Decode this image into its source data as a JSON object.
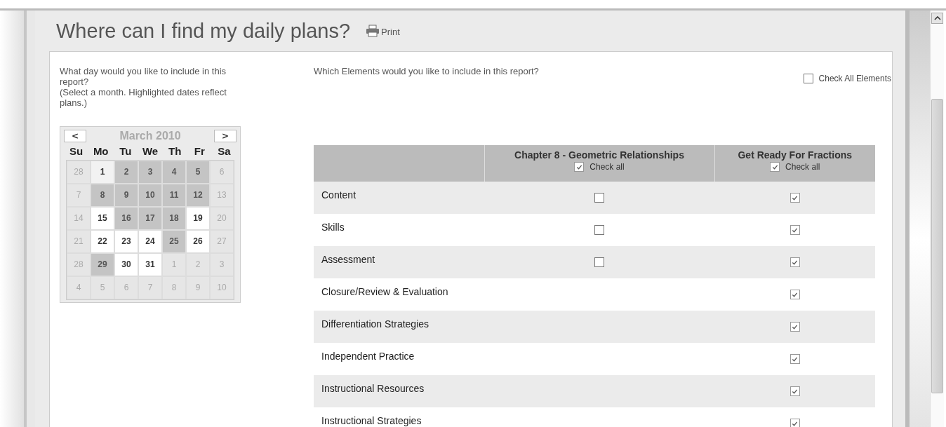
{
  "page": {
    "title": "Where can I find my daily plans?",
    "print_label": "Print"
  },
  "day_prompt": {
    "question": "What day would you like to include in this report?",
    "hint": "(Select a month. Highlighted dates reflect plans.)"
  },
  "elements_prompt": "Which Elements would you like to include in this report?",
  "check_all_elements": {
    "label": "Check All Elements",
    "checked": false
  },
  "calendar": {
    "prev": "<",
    "next": ">",
    "month": "March 2010",
    "weekdays": [
      "Su",
      "Mo",
      "Tu",
      "We",
      "Th",
      "Fr",
      "Sa"
    ],
    "days": [
      {
        "label": "28",
        "kind": "other"
      },
      {
        "label": "1",
        "kind": "today"
      },
      {
        "label": "2",
        "kind": "plan"
      },
      {
        "label": "3",
        "kind": "plan"
      },
      {
        "label": "4",
        "kind": "plan"
      },
      {
        "label": "5",
        "kind": "plan"
      },
      {
        "label": "6",
        "kind": "other"
      },
      {
        "label": "7",
        "kind": "other"
      },
      {
        "label": "8",
        "kind": "plan"
      },
      {
        "label": "9",
        "kind": "plan"
      },
      {
        "label": "10",
        "kind": "plan"
      },
      {
        "label": "11",
        "kind": "plan"
      },
      {
        "label": "12",
        "kind": "plan"
      },
      {
        "label": "13",
        "kind": "other"
      },
      {
        "label": "14",
        "kind": "other"
      },
      {
        "label": "15",
        "kind": "day"
      },
      {
        "label": "16",
        "kind": "plan"
      },
      {
        "label": "17",
        "kind": "plan"
      },
      {
        "label": "18",
        "kind": "plan"
      },
      {
        "label": "19",
        "kind": "day"
      },
      {
        "label": "20",
        "kind": "other"
      },
      {
        "label": "21",
        "kind": "other"
      },
      {
        "label": "22",
        "kind": "day"
      },
      {
        "label": "23",
        "kind": "day"
      },
      {
        "label": "24",
        "kind": "day"
      },
      {
        "label": "25",
        "kind": "plan"
      },
      {
        "label": "26",
        "kind": "day"
      },
      {
        "label": "27",
        "kind": "other"
      },
      {
        "label": "28",
        "kind": "other"
      },
      {
        "label": "29",
        "kind": "plan"
      },
      {
        "label": "30",
        "kind": "day"
      },
      {
        "label": "31",
        "kind": "day"
      },
      {
        "label": "1",
        "kind": "other"
      },
      {
        "label": "2",
        "kind": "other"
      },
      {
        "label": "3",
        "kind": "other"
      },
      {
        "label": "4",
        "kind": "other"
      },
      {
        "label": "5",
        "kind": "other"
      },
      {
        "label": "6",
        "kind": "other"
      },
      {
        "label": "7",
        "kind": "other"
      },
      {
        "label": "8",
        "kind": "other"
      },
      {
        "label": "9",
        "kind": "other"
      },
      {
        "label": "10",
        "kind": "other"
      }
    ]
  },
  "table": {
    "columns": [
      {
        "title": "Chapter 8 - Geometric Relationships",
        "check_all_label": "Check all",
        "checked": true
      },
      {
        "title": "Get Ready For Fractions",
        "check_all_label": "Check all",
        "checked": true
      }
    ],
    "rows": [
      {
        "label": "Content",
        "cells": [
          {
            "checked": false
          },
          {
            "checked": true
          }
        ]
      },
      {
        "label": "Skills",
        "cells": [
          {
            "checked": false
          },
          {
            "checked": true
          }
        ]
      },
      {
        "label": "Assessment",
        "cells": [
          {
            "checked": false
          },
          {
            "checked": true
          }
        ]
      },
      {
        "label": "Closure/Review & Evaluation",
        "cells": [
          null,
          {
            "checked": true
          }
        ]
      },
      {
        "label": "Differentiation Strategies",
        "cells": [
          null,
          {
            "checked": true
          }
        ]
      },
      {
        "label": "Independent Practice",
        "cells": [
          null,
          {
            "checked": true
          }
        ]
      },
      {
        "label": "Instructional Resources",
        "cells": [
          null,
          {
            "checked": true
          }
        ]
      },
      {
        "label": "Instructional Strategies",
        "cells": [
          null,
          {
            "checked": true
          }
        ]
      }
    ]
  }
}
